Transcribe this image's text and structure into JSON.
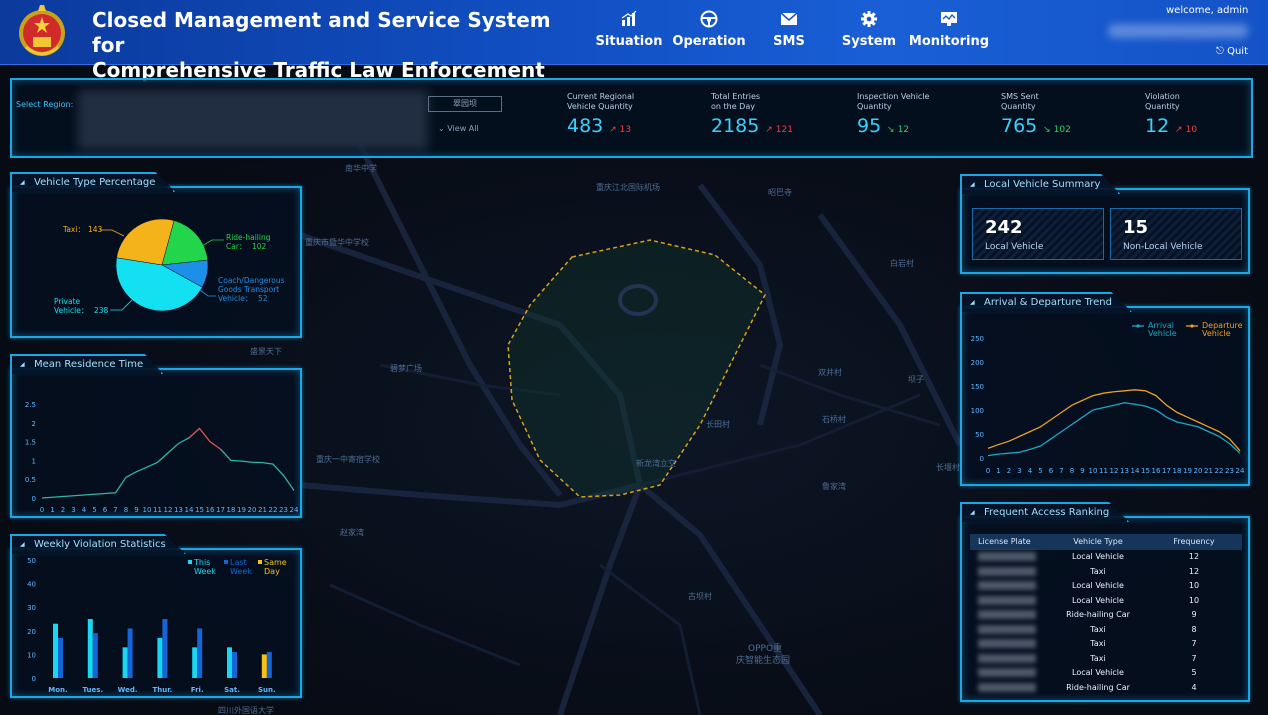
{
  "header": {
    "title_line1": "Closed Management and Service System for",
    "title_line2": "Comprehensive Traffic Law Enforcement",
    "nav": [
      {
        "label": "Situation",
        "icon": "bar-chart-icon"
      },
      {
        "label": "Operation",
        "icon": "steering-wheel-icon"
      },
      {
        "label": "SMS",
        "icon": "envelope-icon"
      },
      {
        "label": "System",
        "icon": "gear-icon"
      },
      {
        "label": "Monitoring",
        "icon": "monitor-icon"
      }
    ],
    "welcome": "welcome, admin",
    "quit": "Quit"
  },
  "topbar": {
    "region_label": "Select Region:",
    "region_button": "翠园坝",
    "view_all": "View All",
    "stats": [
      {
        "label1": "Current Regional",
        "label2": "Vehicle Quantity",
        "value": "483",
        "change": "13",
        "dir": "up"
      },
      {
        "label1": "Total Entries",
        "label2": "on the Day",
        "value": "2185",
        "change": "121",
        "dir": "up"
      },
      {
        "label1": "Inspection Vehicle",
        "label2": "Quantity",
        "value": "95",
        "change": "12",
        "dir": "down"
      },
      {
        "label1": "SMS Sent",
        "label2": "Quantity",
        "value": "765",
        "change": "102",
        "dir": "down"
      },
      {
        "label1": "Violation",
        "label2": "Quantity",
        "value": "12",
        "change": "10",
        "dir": "up"
      }
    ]
  },
  "vehicle_type": {
    "title": "Vehicle Type Percentage",
    "slices": [
      {
        "name": "Taxi",
        "label": "Taxi：",
        "value": 143,
        "color": "#f5b31b"
      },
      {
        "name": "Ride-hailing Car",
        "label1": "Ride-hailing",
        "label2": "Car：",
        "value": 102,
        "color": "#22d54a"
      },
      {
        "name": "Coach/Dangerous Goods Transport Vehicle",
        "label1": "Coach/Dangerous",
        "label2": "Goods Transport",
        "label3": "Vehicle：",
        "value": 52,
        "color": "#1e8fe8"
      },
      {
        "name": "Private Vehicle",
        "label1": "Private",
        "label2": "Vehicle：",
        "value": 238,
        "color": "#13e0f0"
      }
    ]
  },
  "residence": {
    "title": "Mean Residence Time",
    "y_ticks": [
      "2.5",
      "2",
      "1.5",
      "1",
      "0.5",
      "0"
    ],
    "x_ticks": [
      "0",
      "1",
      "2",
      "3",
      "4",
      "5",
      "6",
      "7",
      "8",
      "9",
      "10",
      "11",
      "12",
      "13",
      "14",
      "15",
      "16",
      "17",
      "18",
      "19",
      "20",
      "21",
      "22",
      "23",
      "24"
    ]
  },
  "weekly": {
    "title": "Weekly Violation Statistics",
    "legend": [
      {
        "label1": "This",
        "label2": "Week",
        "color": "#19d7f2"
      },
      {
        "label1": "Last",
        "label2": "Week",
        "color": "#1565d6"
      },
      {
        "label1": "Same",
        "label2": "Day",
        "color": "#f5c218"
      }
    ],
    "y_ticks": [
      "50",
      "40",
      "30",
      "20",
      "10",
      "0"
    ],
    "days": [
      "Mon.",
      "Tues.",
      "Wed.",
      "Thur.",
      "Fri.",
      "Sat.",
      "Sun."
    ]
  },
  "local_summary": {
    "title": "Local Vehicle Summary",
    "local_value": "242",
    "local_label": "Local Vehicle",
    "nonlocal_value": "15",
    "nonlocal_label": "Non-Local Vehicle"
  },
  "trend": {
    "title": "Arrival & Departure Trend",
    "legend_arrival1": "Arrival",
    "legend_arrival2": "Vehicle",
    "legend_departure1": "Departure",
    "legend_departure2": "Vehicle",
    "y_ticks": [
      "250",
      "200",
      "150",
      "100",
      "50",
      "0"
    ],
    "x_ticks": [
      "0",
      "1",
      "2",
      "3",
      "4",
      "5",
      "6",
      "7",
      "8",
      "9",
      "10",
      "11",
      "12",
      "13",
      "14",
      "15",
      "16",
      "17",
      "18",
      "19",
      "20",
      "21",
      "22",
      "23",
      "24"
    ]
  },
  "ranking": {
    "title": "Frequent Access Ranking",
    "headers": [
      "License Plate",
      "Vehicle Type",
      "Frequency"
    ],
    "rows": [
      {
        "type": "Local Vehicle",
        "freq": "12"
      },
      {
        "type": "Taxi",
        "freq": "12"
      },
      {
        "type": "Local Vehicle",
        "freq": "10"
      },
      {
        "type": "Local Vehicle",
        "freq": "10"
      },
      {
        "type": "Ride-hailing Car",
        "freq": "9"
      },
      {
        "type": "Taxi",
        "freq": "8"
      },
      {
        "type": "Taxi",
        "freq": "7"
      },
      {
        "type": "Taxi",
        "freq": "7"
      },
      {
        "type": "Local Vehicle",
        "freq": "5"
      },
      {
        "type": "Ride-hailing Car",
        "freq": "4"
      }
    ]
  },
  "map_labels": [
    {
      "text": "南华中学"
    },
    {
      "text": "重庆江北国际机场"
    },
    {
      "text": "昭巴寺"
    },
    {
      "text": "重庆市暨华中学校"
    },
    {
      "text": "盛景天下"
    },
    {
      "text": "碧梦广场"
    },
    {
      "text": "双井村"
    },
    {
      "text": "石桥村"
    },
    {
      "text": "长田村"
    },
    {
      "text": "白岩村"
    },
    {
      "text": "新龙湾立交"
    },
    {
      "text": "重庆一中寄宿学校"
    },
    {
      "text": "鲁家湾"
    },
    {
      "text": "长堰村"
    },
    {
      "text": "赵家湾"
    },
    {
      "text": "古坝村"
    },
    {
      "text": "OPPO重"
    },
    {
      "text": "庆智能生态园"
    },
    {
      "text": "四川外国语大学"
    },
    {
      "text": "坝子"
    }
  ],
  "chart_data": [
    {
      "type": "pie",
      "title": "Vehicle Type Percentage",
      "categories": [
        "Taxi",
        "Ride-hailing Car",
        "Coach/Dangerous Goods Transport Vehicle",
        "Private Vehicle"
      ],
      "values": [
        143,
        102,
        52,
        238
      ]
    },
    {
      "type": "line",
      "title": "Mean Residence Time",
      "x": [
        0,
        1,
        2,
        3,
        4,
        5,
        6,
        7,
        8,
        9,
        10,
        11,
        12,
        13,
        14,
        15,
        16,
        17,
        18,
        19,
        20,
        21,
        22,
        23,
        24
      ],
      "series": [
        {
          "values": [
            0,
            0.02,
            0.04,
            0.06,
            0.08,
            0.1,
            0.12,
            0.14,
            0.55,
            0.7,
            0.82,
            0.95,
            1.2,
            1.45,
            1.6,
            1.85,
            1.5,
            1.3,
            1.0,
            0.98,
            0.95,
            0.94,
            0.9,
            0.6,
            0.2
          ]
        }
      ],
      "ylim": [
        0,
        2.5
      ]
    },
    {
      "type": "bar",
      "title": "Weekly Violation Statistics",
      "categories": [
        "Mon.",
        "Tues.",
        "Wed.",
        "Thur.",
        "Fri.",
        "Sat.",
        "Sun."
      ],
      "series": [
        {
          "name": "This Week",
          "values": [
            23,
            25,
            13,
            17,
            13,
            13,
            0
          ]
        },
        {
          "name": "Last Week",
          "values": [
            17,
            19,
            21,
            25,
            21,
            11,
            11
          ]
        },
        {
          "name": "Same Day",
          "values": [
            0,
            0,
            0,
            0,
            0,
            0,
            10
          ]
        }
      ],
      "ylim": [
        0,
        50
      ]
    },
    {
      "type": "line",
      "title": "Arrival & Departure Trend",
      "x": [
        0,
        1,
        2,
        3,
        4,
        5,
        6,
        7,
        8,
        9,
        10,
        11,
        12,
        13,
        14,
        15,
        16,
        17,
        18,
        19,
        20,
        21,
        22,
        23,
        24
      ],
      "series": [
        {
          "name": "Arrival Vehicle",
          "values": [
            5,
            8,
            10,
            12,
            18,
            25,
            40,
            55,
            70,
            85,
            100,
            105,
            110,
            115,
            112,
            108,
            100,
            85,
            75,
            70,
            65,
            55,
            45,
            30,
            10
          ]
        },
        {
          "name": "Departure Vehicle",
          "values": [
            20,
            28,
            35,
            45,
            55,
            65,
            80,
            95,
            110,
            120,
            130,
            135,
            138,
            140,
            142,
            140,
            130,
            110,
            95,
            85,
            75,
            65,
            55,
            40,
            15
          ]
        }
      ],
      "ylim": [
        0,
        250
      ]
    }
  ]
}
